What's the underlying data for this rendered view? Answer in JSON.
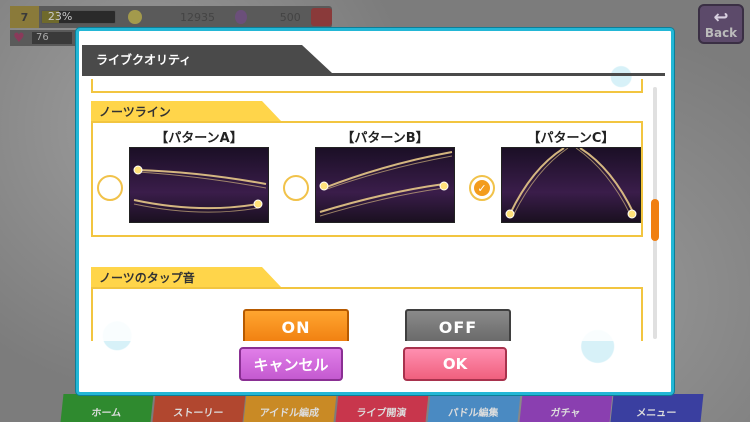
{
  "hud": {
    "level": "7",
    "exp_percent": "23%",
    "exp_fill": 0.23,
    "coins": "12935",
    "gems": "500",
    "stamina": "76"
  },
  "back_button": {
    "label": "Back"
  },
  "bottom_nav": {
    "tabs": [
      "ホーム",
      "ストーリー",
      "アイドル編成",
      "ライブ開演",
      "パドル編集",
      "ガチャ",
      "メニュー"
    ],
    "tab_colors": [
      "#2f8a2f",
      "#b1472f",
      "#c98a25",
      "#c8364c",
      "#4a8ac2",
      "#8a3fb0",
      "#3a3fa0"
    ]
  },
  "dialog": {
    "title": "ライブクオリティ",
    "notes_line": {
      "title": "ノーツライン",
      "patterns": [
        {
          "label": "【パターンA】",
          "selected": false
        },
        {
          "label": "【パターンB】",
          "selected": false
        },
        {
          "label": "【パターンC】",
          "selected": true
        }
      ]
    },
    "tap_sound": {
      "title": "ノーツのタップ音",
      "on_label": "ON",
      "off_label": "OFF",
      "selected": "ON"
    },
    "cancel_label": "キャンセル",
    "ok_label": "OK"
  },
  "colors": {
    "frame": "#23b7d6",
    "section_accent": "#ffd54a",
    "on_button": "#f07f10",
    "cancel_button": "#c45ad0",
    "ok_button": "#f0607e"
  }
}
